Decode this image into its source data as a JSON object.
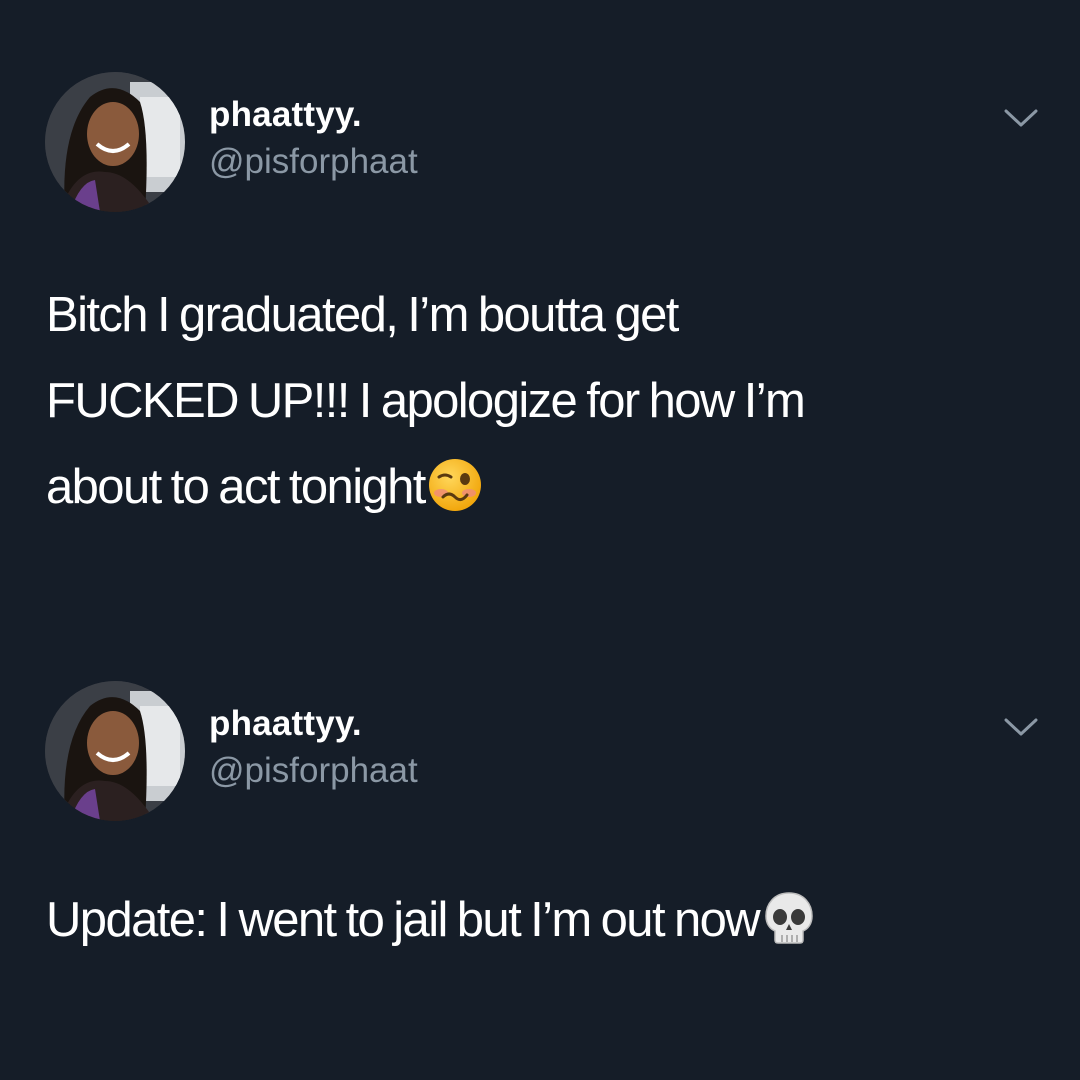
{
  "tweets": [
    {
      "display_name": "phaattyy.",
      "handle": "@pisforphaat",
      "text": "Bitch I graduated, I’m boutta get\nFUCKED UP!!! I apologize for how I’m\nabout to act tonight",
      "trailing_emoji": "woozy-face-emoji"
    },
    {
      "display_name": "phaattyy.",
      "handle": "@pisforphaat",
      "text": "Update: I went to jail but I’m out now",
      "trailing_emoji": "skull-emoji"
    }
  ],
  "colors": {
    "background": "#151d28",
    "text": "#ffffff",
    "secondary_text": "#8b98a5"
  },
  "icons": {
    "menu": "chevron-down-icon"
  }
}
